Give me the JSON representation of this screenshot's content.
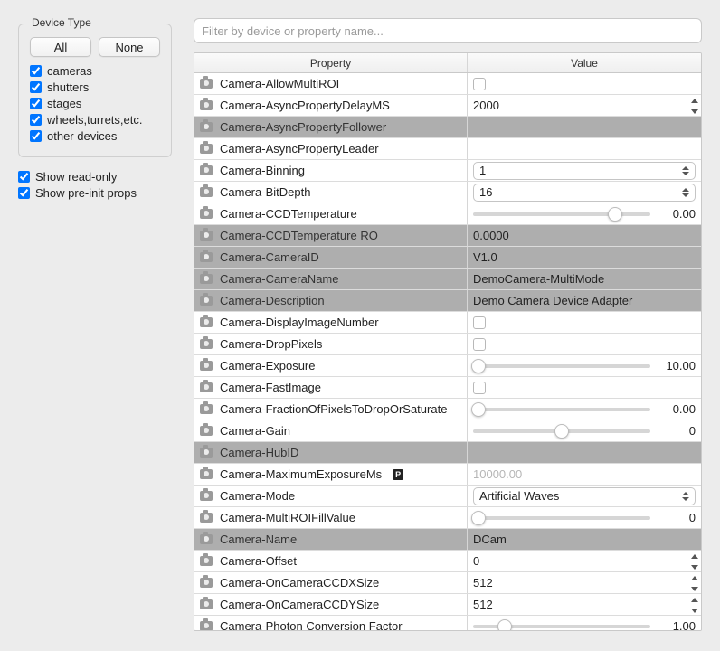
{
  "sidebar": {
    "group_title": "Device Type",
    "all_btn": "All",
    "none_btn": "None",
    "items": [
      {
        "label": "cameras",
        "checked": true
      },
      {
        "label": "shutters",
        "checked": true
      },
      {
        "label": "stages",
        "checked": true
      },
      {
        "label": "wheels,turrets,etc.",
        "checked": true
      },
      {
        "label": "other devices",
        "checked": true
      }
    ],
    "extra": [
      {
        "label": "Show read-only",
        "checked": true
      },
      {
        "label": "Show pre-init props",
        "checked": true
      }
    ]
  },
  "filter_placeholder": "Filter by device or property name...",
  "columns": {
    "c1": "Property",
    "c2": "Value"
  },
  "rows": [
    {
      "name": "Camera-AllowMultiROI",
      "kind": "checkbox",
      "checked": false,
      "ro": false
    },
    {
      "name": "Camera-AsyncPropertyDelayMS",
      "kind": "stepper",
      "value": "2000",
      "ro": false
    },
    {
      "name": "Camera-AsyncPropertyFollower",
      "kind": "blank",
      "value": "",
      "ro": true
    },
    {
      "name": "Camera-AsyncPropertyLeader",
      "kind": "blank",
      "value": "",
      "ro": false
    },
    {
      "name": "Camera-Binning",
      "kind": "select",
      "value": "1",
      "ro": false
    },
    {
      "name": "Camera-BitDepth",
      "kind": "select",
      "value": "16",
      "ro": false
    },
    {
      "name": "Camera-CCDTemperature",
      "kind": "slider",
      "value": "0.00",
      "pos": 0.8,
      "ro": false
    },
    {
      "name": "Camera-CCDTemperature RO",
      "kind": "text",
      "value": "0.0000",
      "ro": true
    },
    {
      "name": "Camera-CameraID",
      "kind": "text",
      "value": "V1.0",
      "ro": true
    },
    {
      "name": "Camera-CameraName",
      "kind": "text",
      "value": "DemoCamera-MultiMode",
      "ro": true
    },
    {
      "name": "Camera-Description",
      "kind": "text",
      "value": "Demo Camera Device Adapter",
      "ro": true
    },
    {
      "name": "Camera-DisplayImageNumber",
      "kind": "checkbox",
      "checked": false,
      "ro": false
    },
    {
      "name": "Camera-DropPixels",
      "kind": "checkbox",
      "checked": false,
      "ro": false
    },
    {
      "name": "Camera-Exposure",
      "kind": "slider",
      "value": "10.00",
      "pos": 0.03,
      "ro": false
    },
    {
      "name": "Camera-FastImage",
      "kind": "checkbox",
      "checked": false,
      "ro": false
    },
    {
      "name": "Camera-FractionOfPixelsToDropOrSaturate",
      "kind": "slider",
      "value": "0.00",
      "pos": 0.03,
      "ro": false
    },
    {
      "name": "Camera-Gain",
      "kind": "slider",
      "value": "0",
      "pos": 0.5,
      "ro": false
    },
    {
      "name": "Camera-HubID",
      "kind": "blank",
      "value": "",
      "ro": true
    },
    {
      "name": "Camera-MaximumExposureMs",
      "kind": "muted",
      "value": "10000.00",
      "badge": "P",
      "ro": false
    },
    {
      "name": "Camera-Mode",
      "kind": "select",
      "value": "Artificial Waves",
      "ro": false
    },
    {
      "name": "Camera-MultiROIFillValue",
      "kind": "slider",
      "value": "0",
      "pos": 0.03,
      "ro": false
    },
    {
      "name": "Camera-Name",
      "kind": "text",
      "value": "DCam",
      "ro": true
    },
    {
      "name": "Camera-Offset",
      "kind": "stepper",
      "value": "0",
      "ro": false
    },
    {
      "name": "Camera-OnCameraCCDXSize",
      "kind": "stepper",
      "value": "512",
      "ro": false
    },
    {
      "name": "Camera-OnCameraCCDYSize",
      "kind": "stepper",
      "value": "512",
      "ro": false
    },
    {
      "name": "Camera-Photon Conversion Factor",
      "kind": "slider",
      "value": "1.00",
      "pos": 0.18,
      "ro": false
    }
  ]
}
